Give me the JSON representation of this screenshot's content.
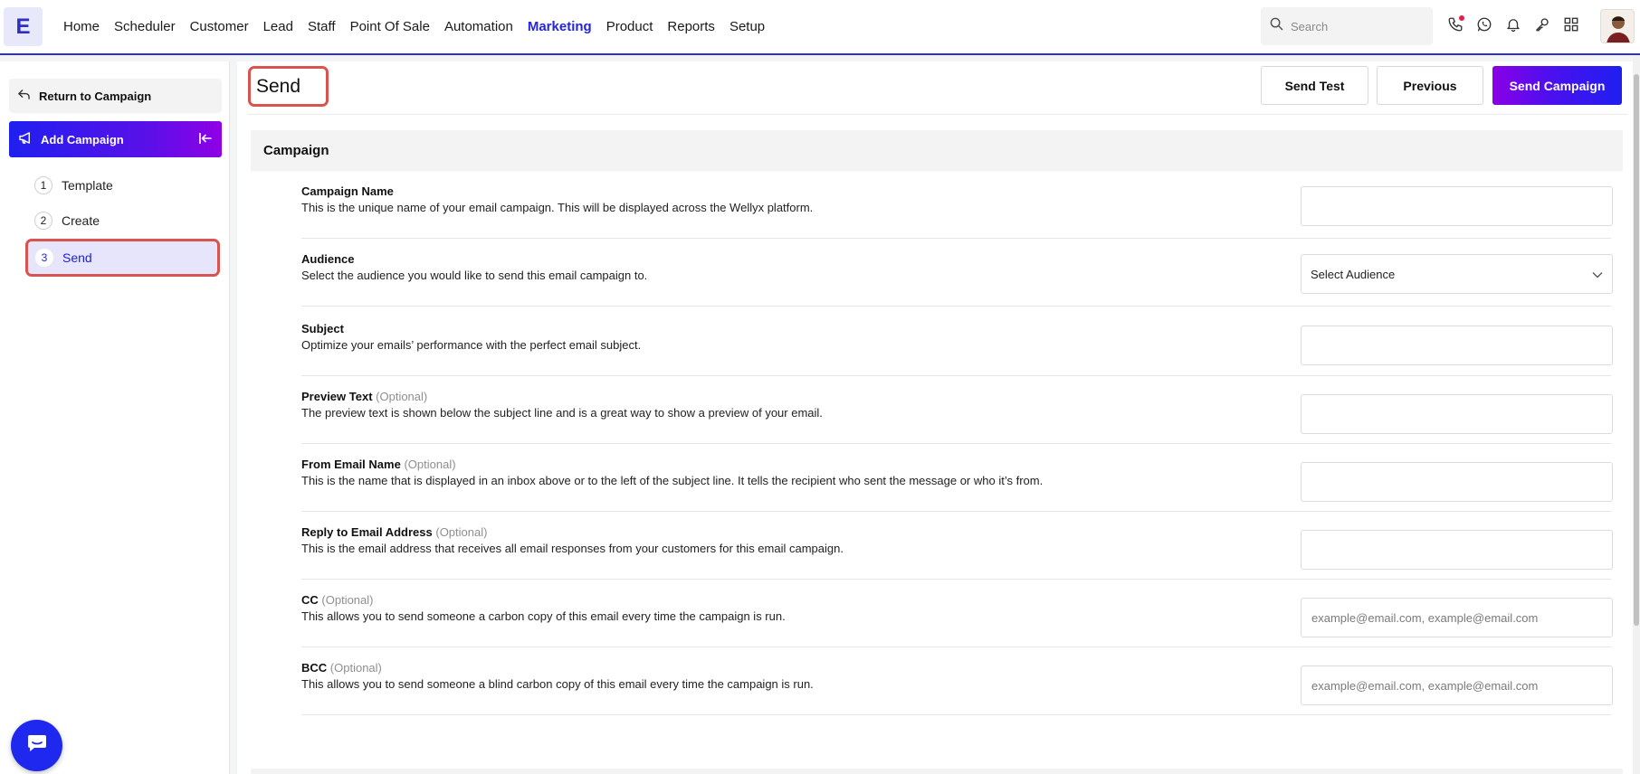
{
  "logo": {
    "letter": "E"
  },
  "nav": {
    "items": [
      {
        "label": "Home",
        "active": false
      },
      {
        "label": "Scheduler",
        "active": false
      },
      {
        "label": "Customer",
        "active": false
      },
      {
        "label": "Lead",
        "active": false
      },
      {
        "label": "Staff",
        "active": false
      },
      {
        "label": "Point Of Sale",
        "active": false
      },
      {
        "label": "Automation",
        "active": false
      },
      {
        "label": "Marketing",
        "active": true
      },
      {
        "label": "Product",
        "active": false
      },
      {
        "label": "Reports",
        "active": false
      },
      {
        "label": "Setup",
        "active": false
      }
    ],
    "active_color": "#2525d9"
  },
  "search": {
    "placeholder": "Search"
  },
  "top_icons": [
    "phone-icon",
    "whatsapp-icon",
    "bell-icon",
    "key-icon",
    "apps-grid-icon"
  ],
  "sidebar": {
    "return_label": "Return to Campaign",
    "add_campaign_label": "Add Campaign",
    "steps": [
      {
        "num": "1",
        "label": "Template",
        "active": false
      },
      {
        "num": "2",
        "label": "Create",
        "active": false
      },
      {
        "num": "3",
        "label": "Send",
        "active": true
      }
    ]
  },
  "main": {
    "title": "Send",
    "buttons": {
      "send_test": "Send Test",
      "previous": "Previous",
      "send_campaign": "Send Campaign"
    },
    "section_title": "Campaign",
    "fields": [
      {
        "title": "Campaign Name",
        "optional": "",
        "desc": "This is the unique name of your email campaign. This will be displayed across the Wellyx platform.",
        "type": "text",
        "value": "",
        "placeholder": ""
      },
      {
        "title": "Audience",
        "optional": "",
        "desc": "Select the audience you would like to send this email campaign to.",
        "type": "select",
        "value": "Select Audience",
        "placeholder": ""
      },
      {
        "title": "Subject",
        "optional": "",
        "desc": "Optimize your emails’ performance with the perfect email subject.",
        "type": "text",
        "value": "",
        "placeholder": ""
      },
      {
        "title": "Preview Text",
        "optional": "(Optional)",
        "desc": "The preview text is shown below the subject line and is a great way to show a preview of your email.",
        "type": "text",
        "value": "",
        "placeholder": ""
      },
      {
        "title": "From Email Name",
        "optional": "(Optional)",
        "desc": "This is the name that is displayed in an inbox above or to the left of the subject line. It tells the recipient who sent the message or who it’s from.",
        "type": "text",
        "value": "",
        "placeholder": ""
      },
      {
        "title": "Reply to Email Address",
        "optional": "(Optional)",
        "desc": "This is the email address that receives all email responses from your customers for this email campaign.",
        "type": "text",
        "value": "",
        "placeholder": ""
      },
      {
        "title": "CC",
        "optional": "(Optional)",
        "desc": "This allows you to send someone a carbon copy of this email every time the campaign is run.",
        "type": "text",
        "value": "",
        "placeholder": "example@email.com, example@email.com"
      },
      {
        "title": "BCC",
        "optional": "(Optional)",
        "desc": "This allows you to send someone a blind carbon copy of this email every time the campaign is run.",
        "type": "text",
        "value": "",
        "placeholder": "example@email.com, example@email.com"
      }
    ]
  },
  "colors": {
    "brand_blue": "#1f1ff0",
    "brand_purple": "#8f00e6",
    "highlight_red": "#d9534f"
  }
}
